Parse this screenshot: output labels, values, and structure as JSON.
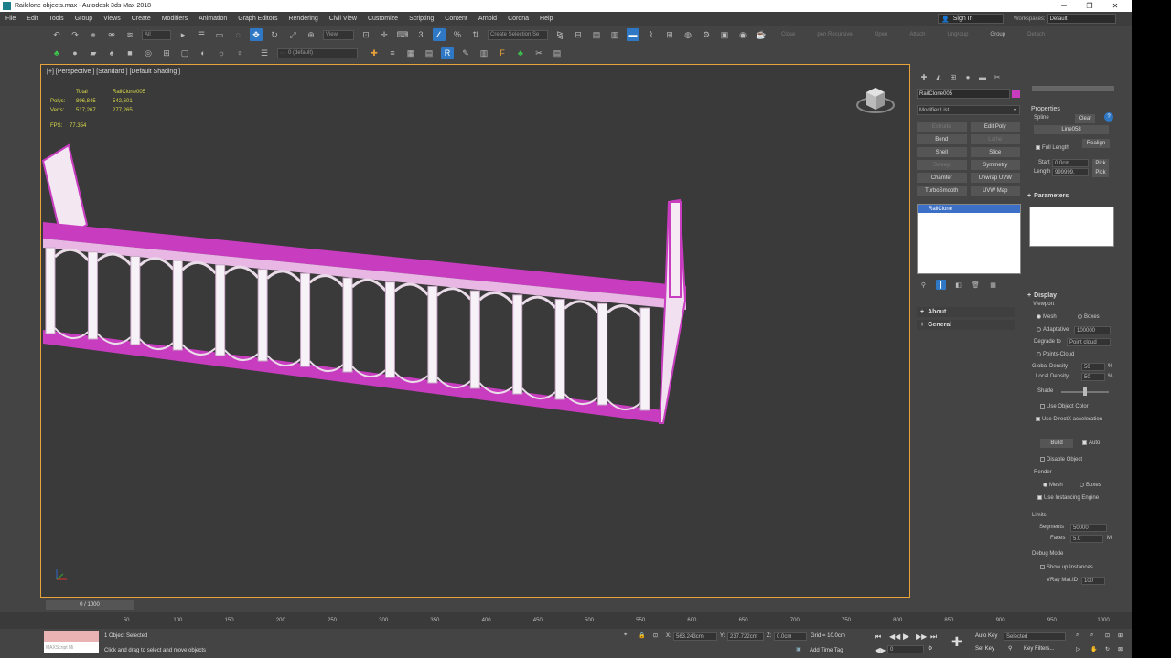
{
  "window": {
    "title": "Railclone objects.max - Autodesk 3ds Max 2018"
  },
  "menu": [
    "File",
    "Edit",
    "Tools",
    "Group",
    "Views",
    "Create",
    "Modifiers",
    "Animation",
    "Graph Editors",
    "Rendering",
    "Civil View",
    "Customize",
    "Scripting",
    "Content",
    "Arnold",
    "Corona",
    "Help"
  ],
  "account": {
    "signin": "Sign In",
    "workspaces_label": "Workspaces:",
    "workspace": "Default"
  },
  "toolbar": {
    "selection_filter": "All",
    "view_dropdown": "View",
    "create_selection_set": "Create Selection Se",
    "layer_dropdown": "0 (default)",
    "extra_labels": [
      "Close",
      "pen Recursive",
      "Open",
      "Attach",
      "Ungroup",
      "Group",
      "Detach"
    ]
  },
  "viewport": {
    "label": "[+] [Perspective ] [Standard ] [Default Shading ]",
    "stats": {
      "col_total": "Total",
      "col_object": "RailClone005",
      "polys_label": "Polys:",
      "polys_total": "896,845",
      "polys_object": "542,601",
      "verts_label": "Verts:",
      "verts_total": "517,267",
      "verts_object": "277,265",
      "fps_label": "FPS:",
      "fps_value": "77.354"
    }
  },
  "command_panel": {
    "object_name": "RailClone005",
    "object_color": "#c83cc0",
    "modifier_list": "Modifier List",
    "modifier_buttons": [
      {
        "label": "Extrude",
        "enabled": false
      },
      {
        "label": "Edit Poly",
        "enabled": true
      },
      {
        "label": "Bend",
        "enabled": true
      },
      {
        "label": "Lathe",
        "enabled": false
      },
      {
        "label": "Shell",
        "enabled": true
      },
      {
        "label": "Slice",
        "enabled": true
      },
      {
        "label": "Sweep",
        "enabled": false
      },
      {
        "label": "Symmetry",
        "enabled": true
      },
      {
        "label": "Chamfer",
        "enabled": true
      },
      {
        "label": "Unwrap UVW",
        "enabled": true
      },
      {
        "label": "TurboSmooth",
        "enabled": true
      },
      {
        "label": "UVW Map",
        "enabled": true
      }
    ],
    "stack_selected": "RailClone",
    "rollouts": [
      "About",
      "General"
    ]
  },
  "properties": {
    "heading": "Properties",
    "spline_label": "Spline",
    "clear_button": "Clear",
    "spline_name": "Line058",
    "full_length": "Full Length",
    "realign": "Realign",
    "start_label": "Start",
    "start_value": "0.0cm",
    "length_label": "Length",
    "length_value": "999999.",
    "pick": "Pick",
    "parameters": "Parameters",
    "display": "Display",
    "viewport_label": "Viewport",
    "mesh": "Mesh",
    "boxes": "Boxes",
    "adaptative": "Adaptative",
    "adaptative_value": "100000",
    "degrade_to": "Degrade to",
    "degrade_value": "Point cloud",
    "points_cloud": "Points-Cloud",
    "global_density": "Global Density",
    "global_density_value": "50",
    "local_density": "Local Density",
    "local_density_value": "50",
    "percent": "%",
    "shade": "Shade",
    "use_object_color": "Use Object Color",
    "use_directx": "Use DirectX acceleration",
    "build": "Build",
    "auto": "Auto",
    "disable_object": "Disable Object",
    "render": "Render",
    "render_mesh": "Mesh",
    "render_boxes": "Boxes",
    "use_instancing": "Use Instancing Engine",
    "limits": "Limits",
    "segments": "Segments",
    "segments_value": "50000",
    "faces": "Faces",
    "faces_value": "5.0",
    "faces_unit": "M",
    "debug_mode": "Debug Mode",
    "show_up_instances": "Show up Instances",
    "vray_mat_id": "VRay Mat.ID",
    "vray_mat_id_value": "100"
  },
  "timeline": {
    "slider": "0 / 1000",
    "ticks": [
      "50",
      "100",
      "150",
      "200",
      "250",
      "300",
      "350",
      "400",
      "450",
      "500",
      "550",
      "600",
      "650",
      "700",
      "750",
      "800",
      "850",
      "900",
      "950",
      "1000"
    ]
  },
  "status": {
    "maxscript": "MAXScript Mi",
    "selected": "1 Object Selected",
    "hint": "Click and drag to select and move objects",
    "x_label": "X:",
    "x_value": "563.243cm",
    "y_label": "Y:",
    "y_value": "237.722cm",
    "z_label": "Z:",
    "z_value": "0.0cm",
    "grid": "Grid = 10.0cm",
    "add_time_tag": "Add Time Tag",
    "auto_key": "Auto Key",
    "set_key": "Set Key",
    "selected_dd": "Selected",
    "key_filters": "Key Filters...",
    "frame": "0"
  }
}
